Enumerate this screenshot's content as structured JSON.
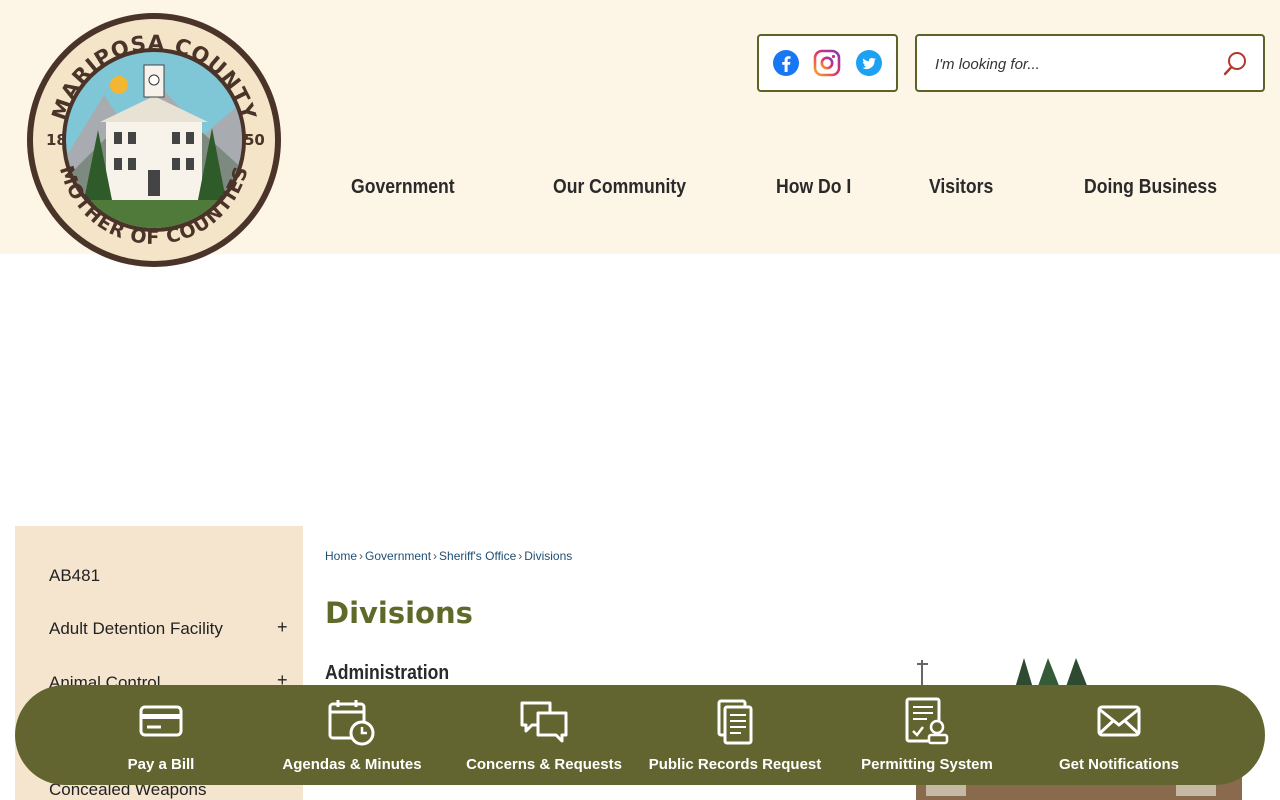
{
  "logo": {
    "top_text": "MARIPOSA COUNTY",
    "bottom_text": "MOTHER OF COUNTIES",
    "year_left": "18",
    "year_right": "50"
  },
  "social": [
    {
      "name": "Facebook",
      "icon": "facebook-icon",
      "color": "#1877f2"
    },
    {
      "name": "Instagram",
      "icon": "instagram-icon",
      "color": "#c13584"
    },
    {
      "name": "Twitter",
      "icon": "twitter-icon",
      "color": "#1da1f2"
    }
  ],
  "search": {
    "placeholder": "I'm looking for...",
    "icon": "search-icon",
    "icon_color": "#b3382c"
  },
  "nav": {
    "items": [
      "Government",
      "Our Community",
      "How Do I",
      "Visitors",
      "Doing Business"
    ]
  },
  "sidebar": {
    "items": [
      {
        "label": "AB481",
        "expandable": false
      },
      {
        "label": "Adult Detention Facility",
        "expandable": true,
        "toggle": "+"
      },
      {
        "label": "Animal Control",
        "expandable": true,
        "toggle": "+"
      },
      {
        "label": "Concealed Weapons",
        "expandable": false
      }
    ]
  },
  "breadcrumb": {
    "items": [
      "Home",
      "Government",
      "Sheriff's Office",
      "Divisions"
    ],
    "separator": "›"
  },
  "page": {
    "title": "Divisions",
    "section_heading": "Administration"
  },
  "quick_links": [
    {
      "label": "Pay a Bill",
      "icon": "credit-card-icon"
    },
    {
      "label": "Agendas & Minutes",
      "icon": "calendar-clock-icon"
    },
    {
      "label": "Concerns & Requests",
      "icon": "chat-bubbles-icon"
    },
    {
      "label": "Public Records Request",
      "icon": "documents-icon"
    },
    {
      "label": "Permitting System",
      "icon": "permit-stamp-icon"
    },
    {
      "label": "Get Notifications",
      "icon": "envelope-icon"
    }
  ],
  "colors": {
    "header_bg": "#fdf5e6",
    "accent_olive": "#626530",
    "title_olive": "#5f6a2a",
    "sidebar_bg": "#f5e5cf",
    "link_blue": "#1f4f73"
  }
}
